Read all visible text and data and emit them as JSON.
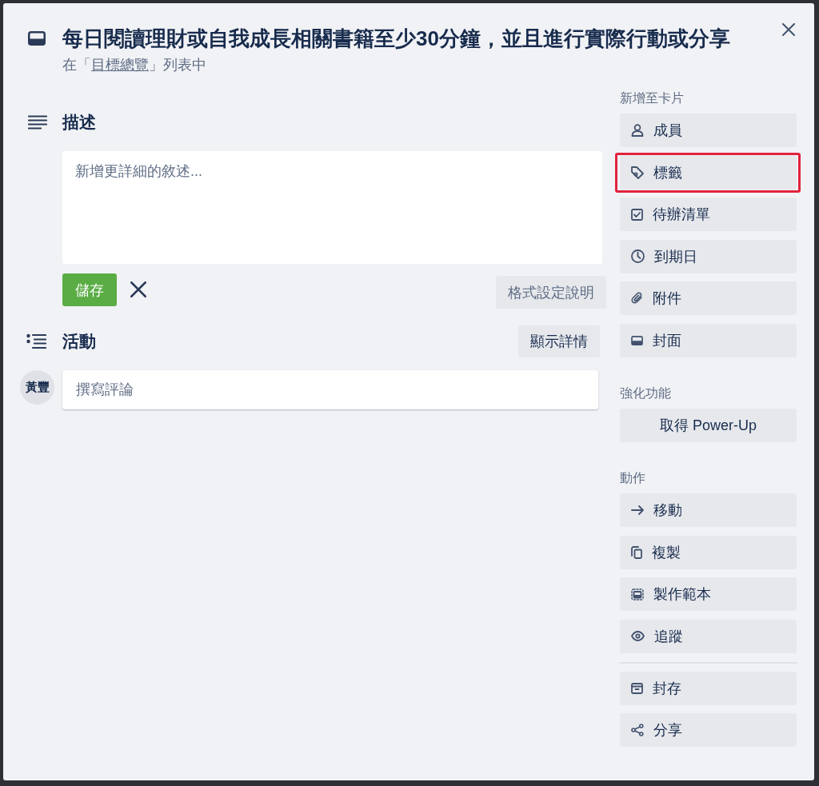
{
  "card": {
    "title": "每日閱讀理財或自我成長相關書籍至少30分鐘，並且進行實際行動或分享",
    "location": {
      "before": "在「",
      "list_name": "目標總覽",
      "after": "」列表中"
    }
  },
  "description": {
    "heading": "描述",
    "editor": {
      "placeholder": "新增更詳細的敘述..."
    },
    "save_button": "儲存",
    "formatting_help_button": "格式設定說明"
  },
  "activity": {
    "heading": "活動",
    "details_button": "顯示詳情",
    "avatar": {
      "initials": "黃豐"
    },
    "comment": {
      "placeholder": "撰寫評論"
    }
  },
  "sidebar": {
    "add_to_card": {
      "heading": "新增至卡片",
      "items": [
        {
          "label": "成員",
          "highlighted": false
        },
        {
          "label": "標籤",
          "highlighted": true
        },
        {
          "label": "待辦清單",
          "highlighted": false
        },
        {
          "label": "到期日",
          "highlighted": false
        },
        {
          "label": "附件",
          "highlighted": false
        },
        {
          "label": "封面",
          "highlighted": false
        }
      ]
    },
    "power_ups": {
      "heading": "強化功能",
      "button": "取得 Power-Up"
    },
    "actions": {
      "heading": "動作",
      "groups": [
        {
          "items": [
            {
              "label": "移動"
            },
            {
              "label": "複製"
            },
            {
              "label": "製作範本"
            },
            {
              "label": "追蹤"
            }
          ]
        },
        {
          "items": [
            {
              "label": "封存"
            },
            {
              "label": "分享"
            }
          ]
        }
      ]
    }
  }
}
